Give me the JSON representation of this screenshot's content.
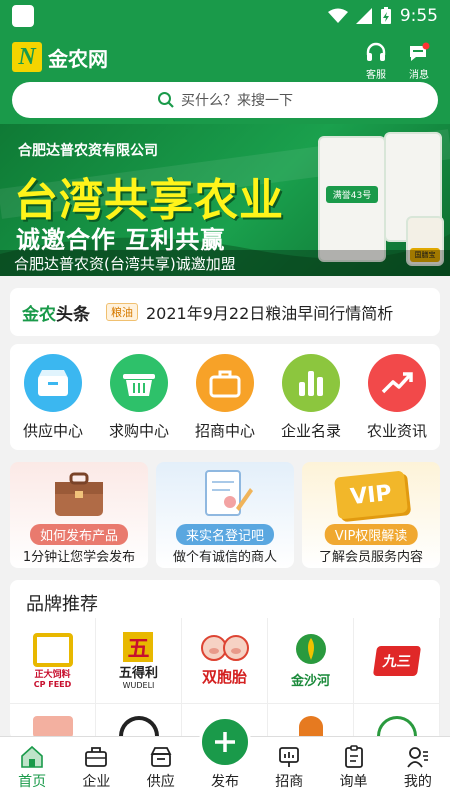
{
  "status": {
    "time": "9:55"
  },
  "header": {
    "logo_mark": "N",
    "app_name": "金农网",
    "service_label": "客服",
    "message_label": "消息",
    "search_placeholder": "买什么？来搜一下"
  },
  "banner": {
    "company": "合肥达普农资有限公司",
    "title": "台湾共享农业",
    "slogan": "诚邀合作 互利共赢",
    "caption": "合肥达普农资(台湾共享)诚邀加盟",
    "product_labels": [
      "满誉43号",
      "国膳宝"
    ]
  },
  "news": {
    "brand_main": "金农",
    "brand_accent": "头条",
    "tag": "粮油",
    "headline": "2021年9月22日粮油早间行情简析"
  },
  "categories": [
    {
      "label": "供应中心",
      "icon": "supply-icon",
      "color": "#3bb7f0"
    },
    {
      "label": "求购中心",
      "icon": "basket-icon",
      "color": "#2ec16a"
    },
    {
      "label": "招商中心",
      "icon": "briefcase-icon",
      "color": "#f7a228"
    },
    {
      "label": "企业名录",
      "icon": "bar-chart-icon",
      "color": "#8cc63e"
    },
    {
      "label": "农业资讯",
      "icon": "trend-icon",
      "color": "#f2494a"
    }
  ],
  "promos": [
    {
      "pill": "如何发布产品",
      "sub": "1分钟让您学会发布"
    },
    {
      "pill": "来实名登记吧",
      "sub": "做个有诚信的商人"
    },
    {
      "pill": "VIP权限解读",
      "sub": "了解会员服务内容",
      "badge": "VIP"
    }
  ],
  "brands": {
    "title": "品牌推荐",
    "items": [
      {
        "name": "正大饲料",
        "sub": "CP FEED"
      },
      {
        "name": "五得利",
        "sub": "WUDELI"
      },
      {
        "name": "双胞胎"
      },
      {
        "name": "金沙河"
      },
      {
        "name": "九三"
      }
    ]
  },
  "tabs": [
    {
      "label": "首页",
      "icon": "home-icon"
    },
    {
      "label": "企业",
      "icon": "company-icon"
    },
    {
      "label": "供应",
      "icon": "supply-tab-icon"
    },
    {
      "label": "发布",
      "icon": "plus-icon"
    },
    {
      "label": "招商",
      "icon": "invest-icon"
    },
    {
      "label": "询单",
      "icon": "inquiry-icon"
    },
    {
      "label": "我的",
      "icon": "profile-icon"
    }
  ],
  "colors": {
    "primary": "#1a9a4a",
    "accent_yellow": "#fff41a"
  }
}
